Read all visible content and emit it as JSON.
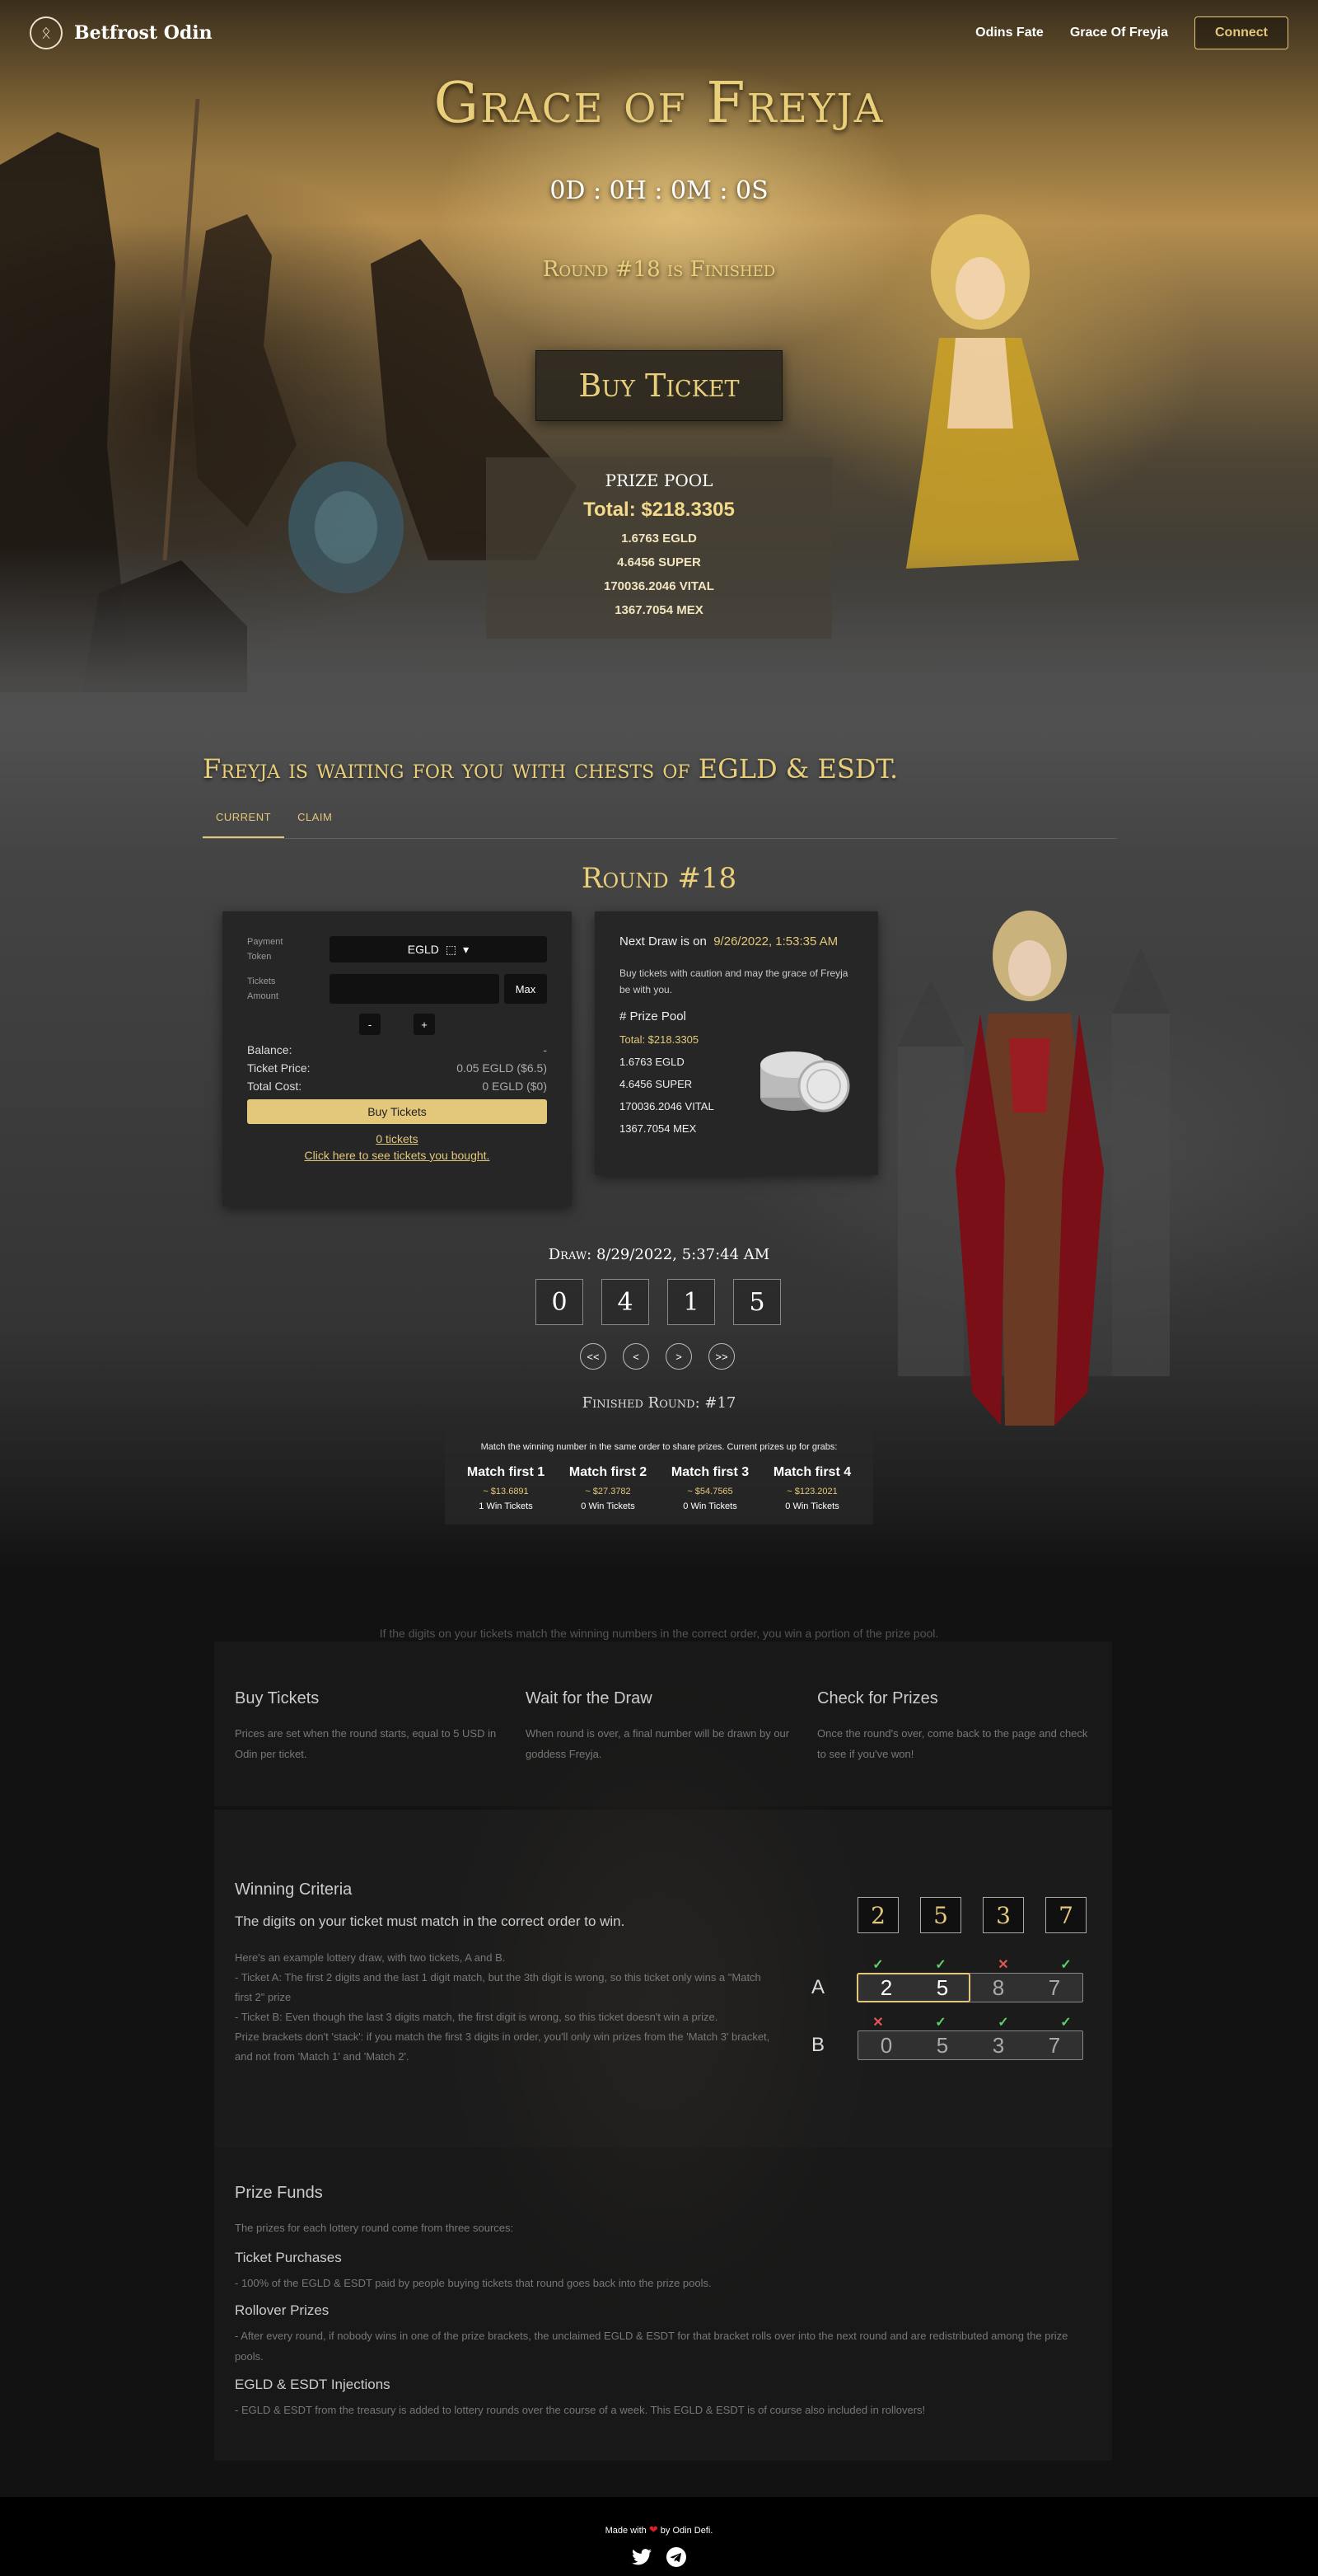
{
  "nav": {
    "brand": "Betfrost Odin",
    "links": [
      "Odins Fate",
      "Grace Of Freyja"
    ],
    "connect": "Connect"
  },
  "hero": {
    "title": "Grace of Freyja",
    "countdown": "0D : 0H : 0M : 0S",
    "round_status": "Round #18 is Finished",
    "buy_button": "Buy Ticket",
    "prize_pool": {
      "title": "PRIZE POOL",
      "total": "Total: $218.3305",
      "items": [
        "1.6763 EGLD",
        "4.6456 SUPER",
        "170036.2046 VITAL",
        "1367.7054 MEX"
      ]
    }
  },
  "lottery": {
    "heading": "Freyja is waiting for you with chests of EGLD & ESDT.",
    "tabs": [
      "CURRENT",
      "CLAIM"
    ],
    "round_title": "Round #18",
    "buy_panel": {
      "payment_token_label_1": "Payment",
      "payment_token_label_2": "Token",
      "token": "EGLD",
      "tickets_label_1": "Tickets",
      "tickets_label_2": "Amount",
      "max": "Max",
      "minus": "-",
      "plus": "+",
      "balance_label": "Balance:",
      "balance_value": "-",
      "price_label": "Ticket Price:",
      "price_value": "0.05 EGLD ($6.5)",
      "cost_label": "Total Cost:",
      "cost_value": "0 EGLD ($0)",
      "buy": "Buy Tickets",
      "tickets_count": "0 tickets",
      "see_tickets": "Click here to see tickets you bought."
    },
    "draw_panel": {
      "next_draw_label": "Next Draw is on",
      "next_draw_value": "9/26/2022, 1:53:35 AM",
      "caution": "Buy tickets with caution and may the grace of Freyja be with you.",
      "pool_head": "# Prize Pool",
      "pool_total": "Total: $218.3305",
      "pool_items": [
        "1.6763 EGLD",
        "4.6456 SUPER",
        "170036.2046 VITAL",
        "1367.7054 MEX"
      ]
    },
    "draw_date": "Draw: 8/29/2022, 5:37:44 AM",
    "winning_digits": [
      "0",
      "4",
      "1",
      "5"
    ],
    "pager": [
      "<<",
      "<",
      ">",
      ">>"
    ],
    "finished_round": "Finished Round: #17",
    "match": {
      "intro": "Match the winning number in the same order to share prizes. Current prizes up for grabs:",
      "brackets": [
        {
          "title": "Match first 1",
          "value": "~ $13.6891",
          "wins": "1 Win Tickets"
        },
        {
          "title": "Match first 2",
          "value": "~ $27.3782",
          "wins": "0 Win Tickets"
        },
        {
          "title": "Match first 3",
          "value": "~ $54.7565",
          "wins": "0 Win Tickets"
        },
        {
          "title": "Match first 4",
          "value": "~ $123.2021",
          "wins": "0 Win Tickets"
        }
      ]
    }
  },
  "how": {
    "intro": "If the digits on your tickets match the winning numbers in the correct order, you win a portion of the prize pool.",
    "steps": [
      {
        "title": "Buy Tickets",
        "desc": "Prices are set when the round starts, equal to 5 USD in Odin per ticket."
      },
      {
        "title": "Wait for the Draw",
        "desc": "When round is over, a final number will be drawn by our goddess Freyja."
      },
      {
        "title": "Check for Prizes",
        "desc": "Once the round's over, come back to the page and check to see if you've won!"
      }
    ]
  },
  "criteria": {
    "title": "Winning Criteria",
    "subtitle": "The digits on your ticket must match in the correct order to win.",
    "lines": [
      "Here's an example lottery draw, with two tickets, A and B.",
      "- Ticket A: The first 2 digits and the last 1 digit match, but the 3th digit is wrong, so this ticket only wins a \"Match first 2\" prize",
      "- Ticket B: Even though the last 3 digits match, the first digit is wrong, so this ticket doesn't win a prize.",
      "Prize brackets don't 'stack': if you match the first 3 digits in order, you'll only win prizes from the 'Match 3' bracket, and not from 'Match 1' and 'Match 2'."
    ],
    "example": {
      "winning": [
        "2",
        "5",
        "3",
        "7"
      ],
      "ticket_a": {
        "label": "A",
        "digits": [
          "2",
          "5",
          "8",
          "7"
        ],
        "marks": [
          "✓",
          "✓",
          "✕",
          "✓"
        ]
      },
      "ticket_b": {
        "label": "B",
        "digits": [
          "0",
          "5",
          "3",
          "7"
        ],
        "marks": [
          "✕",
          "✓",
          "✓",
          "✓"
        ]
      }
    }
  },
  "funds": {
    "title": "Prize Funds",
    "intro": "The prizes for each lottery round come from three sources:",
    "items": [
      {
        "title": "Ticket Purchases",
        "desc": "- 100% of the EGLD & ESDT paid by people buying tickets that round goes back into the prize pools."
      },
      {
        "title": "Rollover Prizes",
        "desc": "- After every round, if nobody wins in one of the prize brackets, the unclaimed EGLD & ESDT for that bracket rolls over into the next round and are redistributed among the prize pools."
      },
      {
        "title": "EGLD & ESDT Injections",
        "desc": "- EGLD & ESDT from the treasury is added to lottery rounds over the course of a week. This EGLD & ESDT is of course also included in rollovers!"
      }
    ]
  },
  "footer": {
    "made_with": "Made with",
    "by": "by Odin Defi.",
    "icons": [
      "heart-icon",
      "twitter-icon",
      "telegram-icon"
    ]
  }
}
